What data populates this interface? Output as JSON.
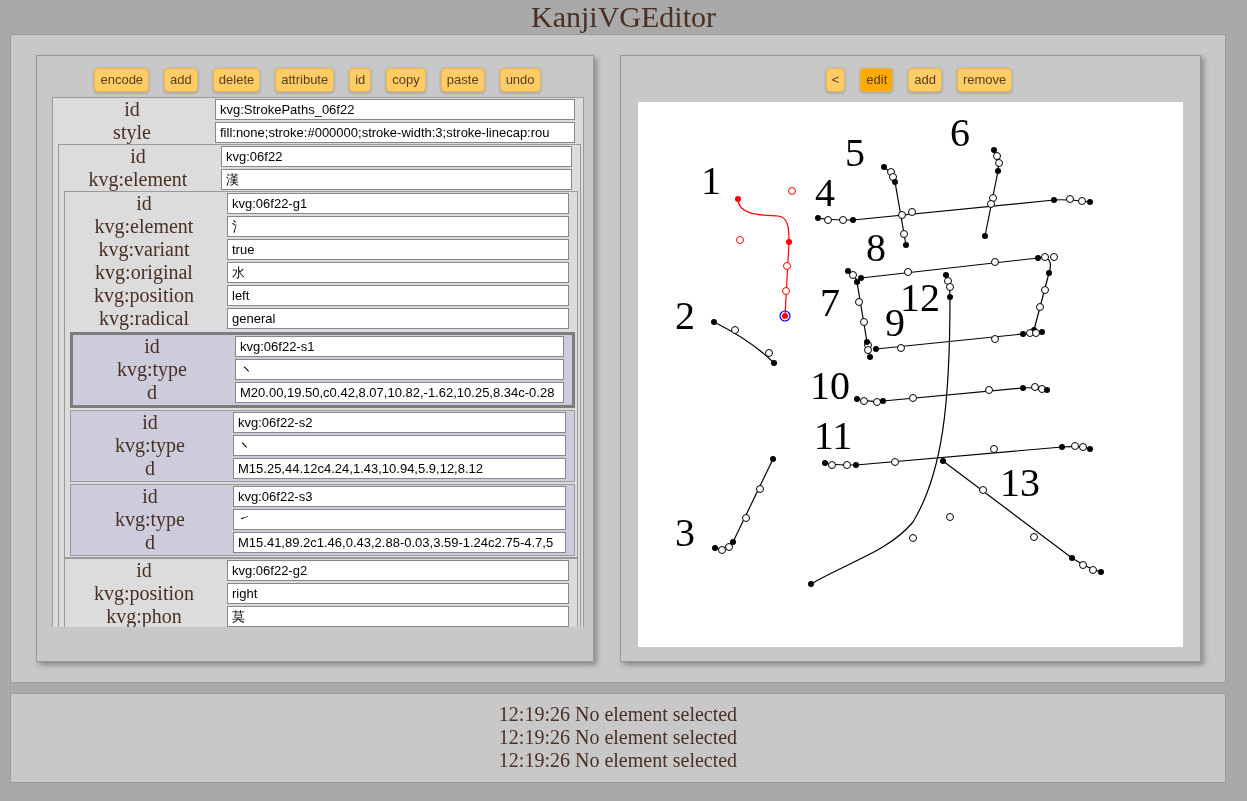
{
  "title": "KanjiVGEditor",
  "tree_toolbar": [
    {
      "label": "encode"
    },
    {
      "label": "add"
    },
    {
      "label": "delete"
    },
    {
      "label": "attribute"
    },
    {
      "label": "id"
    },
    {
      "label": "copy"
    },
    {
      "label": "paste"
    },
    {
      "label": "undo"
    }
  ],
  "tree": {
    "kind": "group",
    "selected": false,
    "attributes": [
      {
        "name": "id",
        "value": "kvg:StrokePaths_06f22"
      },
      {
        "name": "style",
        "value": "fill:none;stroke:#000000;stroke-width:3;stroke-linecap:rou"
      }
    ],
    "children": [
      {
        "kind": "group",
        "selected": false,
        "attributes": [
          {
            "name": "id",
            "value": "kvg:06f22"
          },
          {
            "name": "kvg:element",
            "value": "漢"
          }
        ],
        "children": [
          {
            "kind": "group",
            "selected": false,
            "attributes": [
              {
                "name": "id",
                "value": "kvg:06f22-g1"
              },
              {
                "name": "kvg:element",
                "value": "氵"
              },
              {
                "name": "kvg:variant",
                "value": "true"
              },
              {
                "name": "kvg:original",
                "value": "水"
              },
              {
                "name": "kvg:position",
                "value": "left"
              },
              {
                "name": "kvg:radical",
                "value": "general"
              }
            ],
            "children": [
              {
                "kind": "stroke",
                "selected": true,
                "attributes": [
                  {
                    "name": "id",
                    "value": "kvg:06f22-s1"
                  },
                  {
                    "name": "kvg:type",
                    "value": "㇔"
                  },
                  {
                    "name": "d",
                    "value": "M20.00,19.50,c0.42,8.07,10.82,-1.62,10.25,8.34c-0.28"
                  }
                ]
              },
              {
                "kind": "stroke",
                "selected": false,
                "attributes": [
                  {
                    "name": "id",
                    "value": "kvg:06f22-s2"
                  },
                  {
                    "name": "kvg:type",
                    "value": "㇔"
                  },
                  {
                    "name": "d",
                    "value": "M15.25,44.12c4.24,1.43,10.94,5.9,12,8.12"
                  }
                ]
              },
              {
                "kind": "stroke",
                "selected": false,
                "attributes": [
                  {
                    "name": "id",
                    "value": "kvg:06f22-s3"
                  },
                  {
                    "name": "kvg:type",
                    "value": "㇀"
                  },
                  {
                    "name": "d",
                    "value": "M15.41,89.2c1.46,0.43,2.88-0.03,3.59-1.24c2.75-4.7,5"
                  }
                ]
              }
            ]
          },
          {
            "kind": "group",
            "selected": false,
            "attributes": [
              {
                "name": "id",
                "value": "kvg:06f22-g2"
              },
              {
                "name": "kvg:position",
                "value": "right"
              },
              {
                "name": "kvg:phon",
                "value": "莫"
              }
            ]
          }
        ]
      }
    ]
  },
  "canvas_toolbar": [
    {
      "label": "<",
      "selected": false
    },
    {
      "label": "edit",
      "selected": true
    },
    {
      "label": "add",
      "selected": false
    },
    {
      "label": "remove",
      "selected": false
    }
  ],
  "canvas": {
    "strokes": [
      {
        "label": "1",
        "selected": true
      },
      {
        "label": "2",
        "selected": false
      },
      {
        "label": "3",
        "selected": false
      },
      {
        "label": "4",
        "selected": false
      },
      {
        "label": "5",
        "selected": false
      },
      {
        "label": "6",
        "selected": false
      },
      {
        "label": "7",
        "selected": false
      },
      {
        "label": "8",
        "selected": false
      },
      {
        "label": "9",
        "selected": false
      },
      {
        "label": "10",
        "selected": false
      },
      {
        "label": "11",
        "selected": false
      },
      {
        "label": "12",
        "selected": false
      },
      {
        "label": "13",
        "selected": false
      }
    ]
  },
  "log": [
    "12:19:26 No element selected",
    "12:19:26 No element selected",
    "12:19:26 No element selected"
  ]
}
